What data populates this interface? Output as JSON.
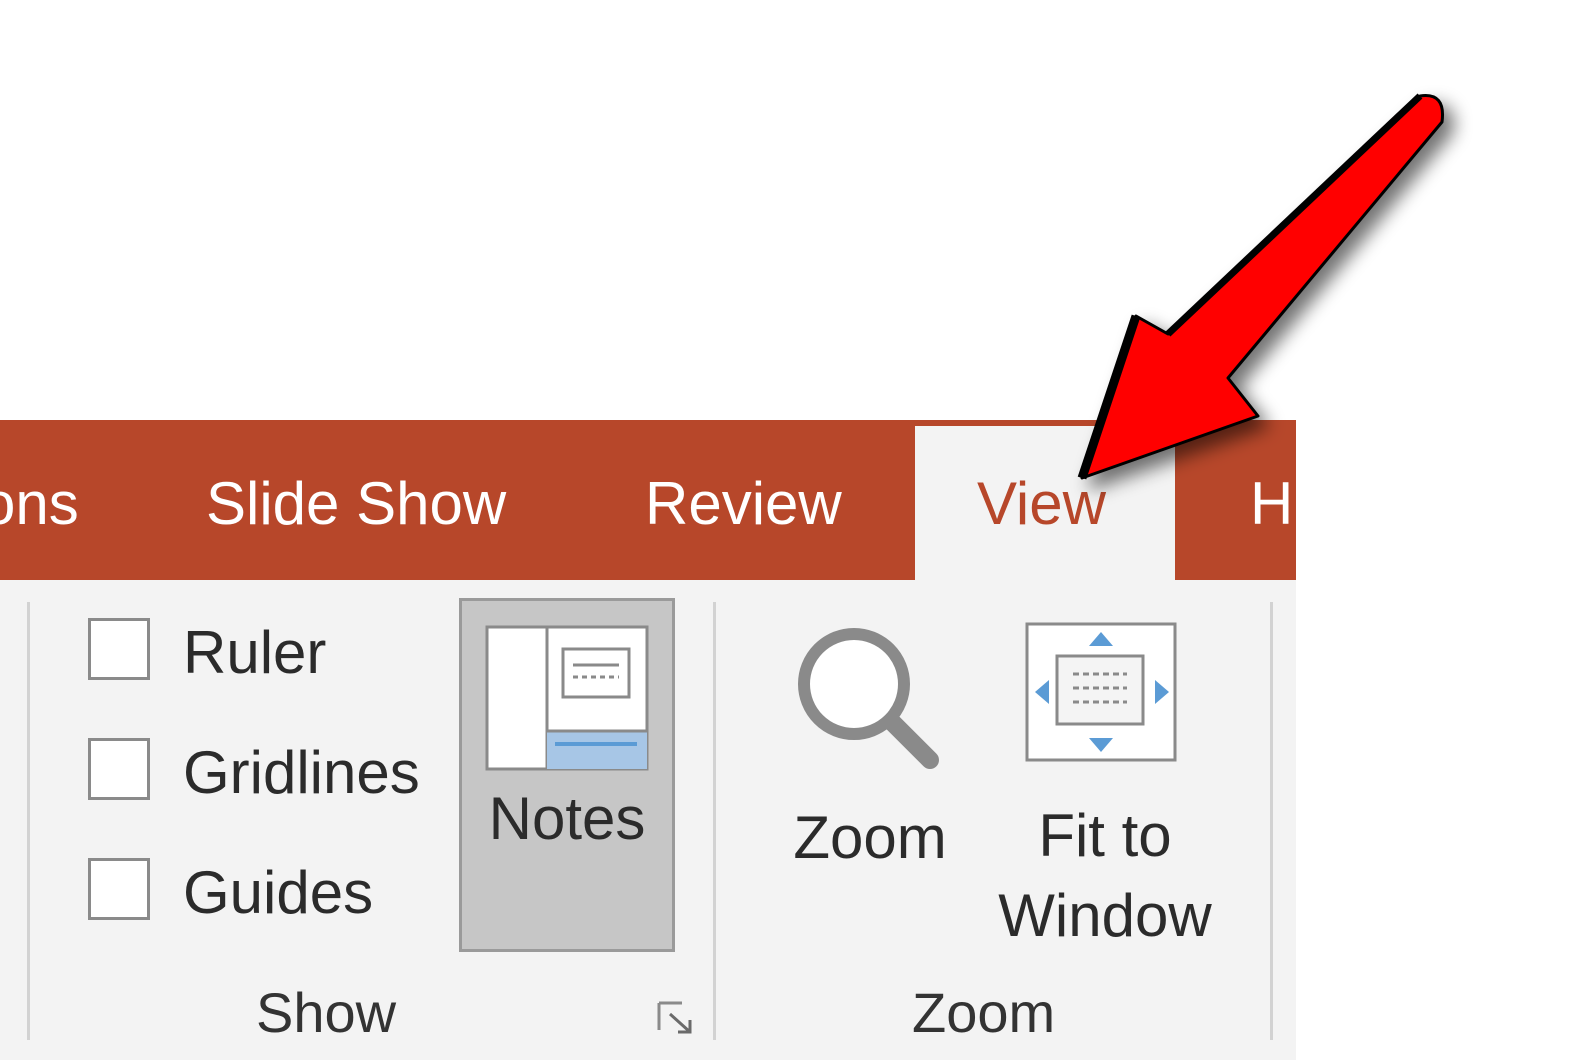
{
  "tabs": [
    {
      "label": "ons"
    },
    {
      "label": "Slide Show"
    },
    {
      "label": "Review"
    },
    {
      "label": "View",
      "active": true
    },
    {
      "label": "H"
    }
  ],
  "show_group": {
    "label": "Show",
    "checkboxes": [
      {
        "label": "Ruler",
        "checked": false
      },
      {
        "label": "Gridlines",
        "checked": false
      },
      {
        "label": "Guides",
        "checked": false
      }
    ],
    "notes_label": "Notes"
  },
  "zoom_group": {
    "label": "Zoom",
    "zoom_label": "Zoom",
    "fit_line1": "Fit to",
    "fit_line2": "Window"
  },
  "colors": {
    "accent": "#b7472a",
    "ribbon_bg": "#f3f3f3",
    "arrow": "#ff0000",
    "icon_blue": "#5b9bd5"
  },
  "icons": [
    "notes-icon",
    "magnifier-icon",
    "fit-to-window-icon",
    "dialog-launcher-icon",
    "annotation-arrow"
  ]
}
